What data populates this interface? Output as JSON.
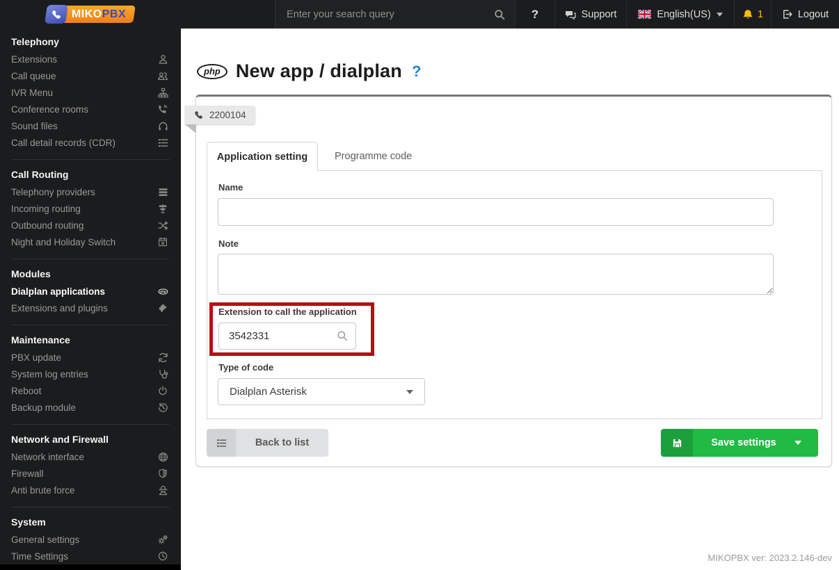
{
  "sidebar": {
    "logo": {
      "brand_primary": "MIKO",
      "brand_secondary": "PBX"
    },
    "sections": [
      {
        "title": "Telephony",
        "items": [
          {
            "label": "Extensions",
            "icon": "user"
          },
          {
            "label": "Call queue",
            "icon": "users"
          },
          {
            "label": "IVR Menu",
            "icon": "sitemap"
          },
          {
            "label": "Conference rooms",
            "icon": "phone-volume"
          },
          {
            "label": "Sound files",
            "icon": "headphones"
          },
          {
            "label": "Call detail records (CDR)",
            "icon": "list"
          }
        ]
      },
      {
        "title": "Call Routing",
        "items": [
          {
            "label": "Telephony providers",
            "icon": "th-list"
          },
          {
            "label": "Incoming routing",
            "icon": "signpost"
          },
          {
            "label": "Outbound routing",
            "icon": "random"
          },
          {
            "label": "Night and Holiday Switch",
            "icon": "calendar-x"
          }
        ]
      },
      {
        "title": "Modules",
        "items": [
          {
            "label": "Dialplan applications",
            "icon": "php",
            "active": true
          },
          {
            "label": "Extensions and plugins",
            "icon": "puzzle"
          }
        ]
      },
      {
        "title": "Maintenance",
        "items": [
          {
            "label": "PBX update",
            "icon": "sync"
          },
          {
            "label": "System log entries",
            "icon": "stethoscope"
          },
          {
            "label": "Reboot",
            "icon": "power"
          },
          {
            "label": "Backup module",
            "icon": "history"
          }
        ]
      },
      {
        "title": "Network and Firewall",
        "items": [
          {
            "label": "Network interface",
            "icon": "globe"
          },
          {
            "label": "Firewall",
            "icon": "shield"
          },
          {
            "label": "Anti brute force",
            "icon": "spy"
          }
        ]
      },
      {
        "title": "System",
        "items": [
          {
            "label": "General settings",
            "icon": "cogs"
          },
          {
            "label": "Time Settings",
            "icon": "clock"
          }
        ]
      }
    ]
  },
  "topbar": {
    "search_placeholder": "Enter your search query",
    "help_mark": "?",
    "support_label": "Support",
    "language_label": "English(US)",
    "notification_count": "1",
    "logout_label": "Logout"
  },
  "main": {
    "title_badge": "php",
    "page_title": "New app / dialplan",
    "title_help": "?",
    "ribbon_label": "2200104",
    "tabs": [
      {
        "label": "Application setting",
        "active": true
      },
      {
        "label": "Programme code",
        "active": false
      }
    ],
    "form": {
      "name_label": "Name",
      "name_value": "",
      "note_label": "Note",
      "note_value": "",
      "extension_label": "Extension to call the application",
      "extension_value": "3542331",
      "type_label": "Type of code",
      "type_value": "Dialplan Asterisk"
    },
    "buttons": {
      "back_label": "Back to list",
      "save_label": "Save settings"
    },
    "footer_version": "MIKOPBX ver: 2023.2.146-dev"
  },
  "colors": {
    "sidebar_bg": "#1b1c1d",
    "accent_green": "#21ba45",
    "annotation_red": "#b40f14",
    "notification_yellow": "#fbbd08",
    "help_blue": "#2185d0",
    "logo_orange": "#f5841f",
    "logo_blue": "#3b4cb8"
  }
}
